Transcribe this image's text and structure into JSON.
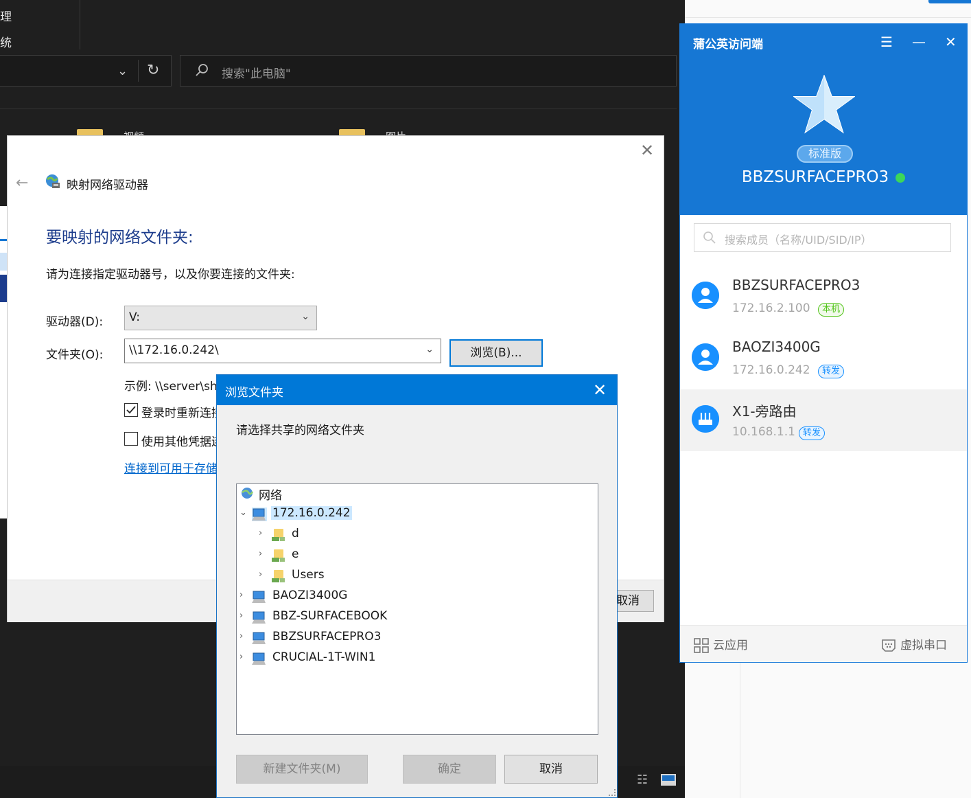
{
  "explorer": {
    "nav_partial_1": "理",
    "nav_partial_2": "统",
    "search_placeholder": "搜索\"此电脑\"",
    "folder_partial_1": "视频",
    "folder_partial_2": "图片"
  },
  "wizard": {
    "window_title": "映射网络驱动器",
    "heading": "要映射的网络文件夹:",
    "description": "请为连接指定驱动器号，以及你要连接的文件夹:",
    "drive_label": "驱动器(D):",
    "drive_value": "V:",
    "folder_label": "文件夹(O):",
    "folder_value": "\\\\172.16.0.242\\",
    "browse_button": "浏览(B)...",
    "example_text": "示例: \\\\server\\share",
    "reconnect_label": "登录时重新连接",
    "reconnect_checked": true,
    "other_credentials_label": "使用其他凭据连接",
    "other_credentials_checked": false,
    "storage_link": "连接到可用于存储文档和图片的网站。",
    "cancel_button": "取消"
  },
  "browse_dialog": {
    "title": "浏览文件夹",
    "prompt": "请选择共享的网络文件夹",
    "tree": [
      {
        "label": "网络",
        "depth": 0,
        "expander": "",
        "icon": "network-icon",
        "selected": false
      },
      {
        "label": "172.16.0.242",
        "depth": 0,
        "expander": "⌄",
        "icon": "computer-icon",
        "selected": true
      },
      {
        "label": "d",
        "depth": 1,
        "expander": "›",
        "icon": "shared-folder-icon",
        "selected": false
      },
      {
        "label": "e",
        "depth": 1,
        "expander": "›",
        "icon": "shared-folder-icon",
        "selected": false
      },
      {
        "label": "Users",
        "depth": 1,
        "expander": "›",
        "icon": "shared-folder-icon",
        "selected": false
      },
      {
        "label": "BAOZI3400G",
        "depth": 0,
        "expander": "›",
        "icon": "computer-icon",
        "selected": false
      },
      {
        "label": "BBZ-SURFACEBOOK",
        "depth": 0,
        "expander": "›",
        "icon": "computer-icon",
        "selected": false
      },
      {
        "label": "BBZSURFACEPRO3",
        "depth": 0,
        "expander": "›",
        "icon": "computer-icon",
        "selected": false
      },
      {
        "label": "CRUCIAL-1T-WIN1",
        "depth": 0,
        "expander": "›",
        "icon": "computer-icon",
        "selected": false
      }
    ],
    "new_folder_button": "新建文件夹(M)",
    "ok_button": "确定",
    "cancel_button": "取消"
  },
  "pgy": {
    "title": "蒲公英访问端",
    "edition_badge": "标准版",
    "device_name": "BBZSURFACEPRO3",
    "online_color": "#3cd65a",
    "search_placeholder": "搜索成员（名称/UID/SID/IP）",
    "members": [
      {
        "name": "BBZSURFACEPRO3",
        "ip": "172.16.2.100",
        "tag": "本机",
        "tag_kind": "local",
        "icon": "user-icon"
      },
      {
        "name": "BAOZI3400G",
        "ip": "172.16.0.242",
        "tag": "转发",
        "tag_kind": "relay",
        "icon": "user-icon"
      },
      {
        "name": "X1-旁路由",
        "ip": "10.168.1.1",
        "tag": "转发",
        "tag_kind": "relay",
        "icon": "router-icon"
      }
    ],
    "cloud_apps": "云应用",
    "virtual_serial": "虚拟串口",
    "accent_color": "#1677d4"
  }
}
